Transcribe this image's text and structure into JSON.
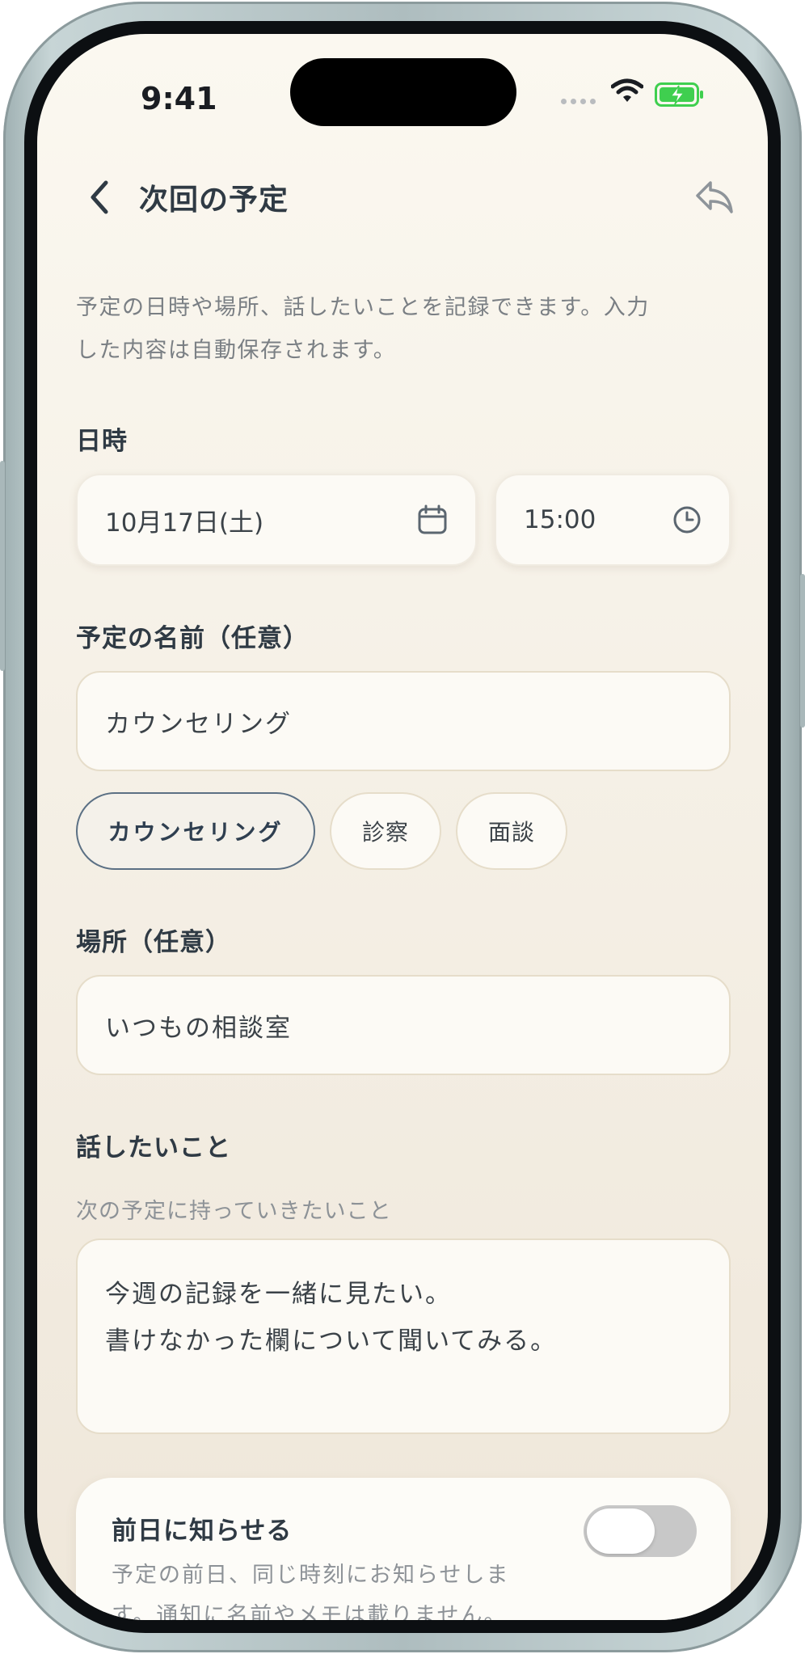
{
  "status_bar": {
    "time": "9:41"
  },
  "header": {
    "title": "次回の予定",
    "back_icon": "chevron-left-icon",
    "share_icon": "reply-arrow-icon"
  },
  "intro_line1": "予定の日時や場所、話したいことを記録できます。入力",
  "intro_line2": "した内容は自動保存されます。",
  "datetime": {
    "label": "日時",
    "date_value": "10月17日(土)",
    "date_icon": "calendar-icon",
    "time_value": "15:00",
    "time_icon": "clock-icon"
  },
  "name": {
    "label": "予定の名前（任意）",
    "value": "カウンセリング",
    "chips": [
      "カウンセリング",
      "診察",
      "面談"
    ],
    "selected_chip": "カウンセリング"
  },
  "place": {
    "label": "場所（任意）",
    "value": "いつもの相談室"
  },
  "topics": {
    "label": "話したいこと",
    "hint": "次の予定に持っていきたいこと",
    "line1": "今週の記録を一緒に見たい。",
    "line2": "書けなかった欄について聞いてみる。"
  },
  "reminder": {
    "title": "前日に知らせる",
    "desc_line1": "予定の前日、同じ時刻にお知らせしま",
    "desc_line2": "す。通知に名前やメモは載りません。",
    "enabled": false
  },
  "colors": {
    "accent": "#5b7084",
    "background": "#f7f2e8",
    "field_border": "#e6ddca",
    "battery_green": "#3fcf4f"
  }
}
